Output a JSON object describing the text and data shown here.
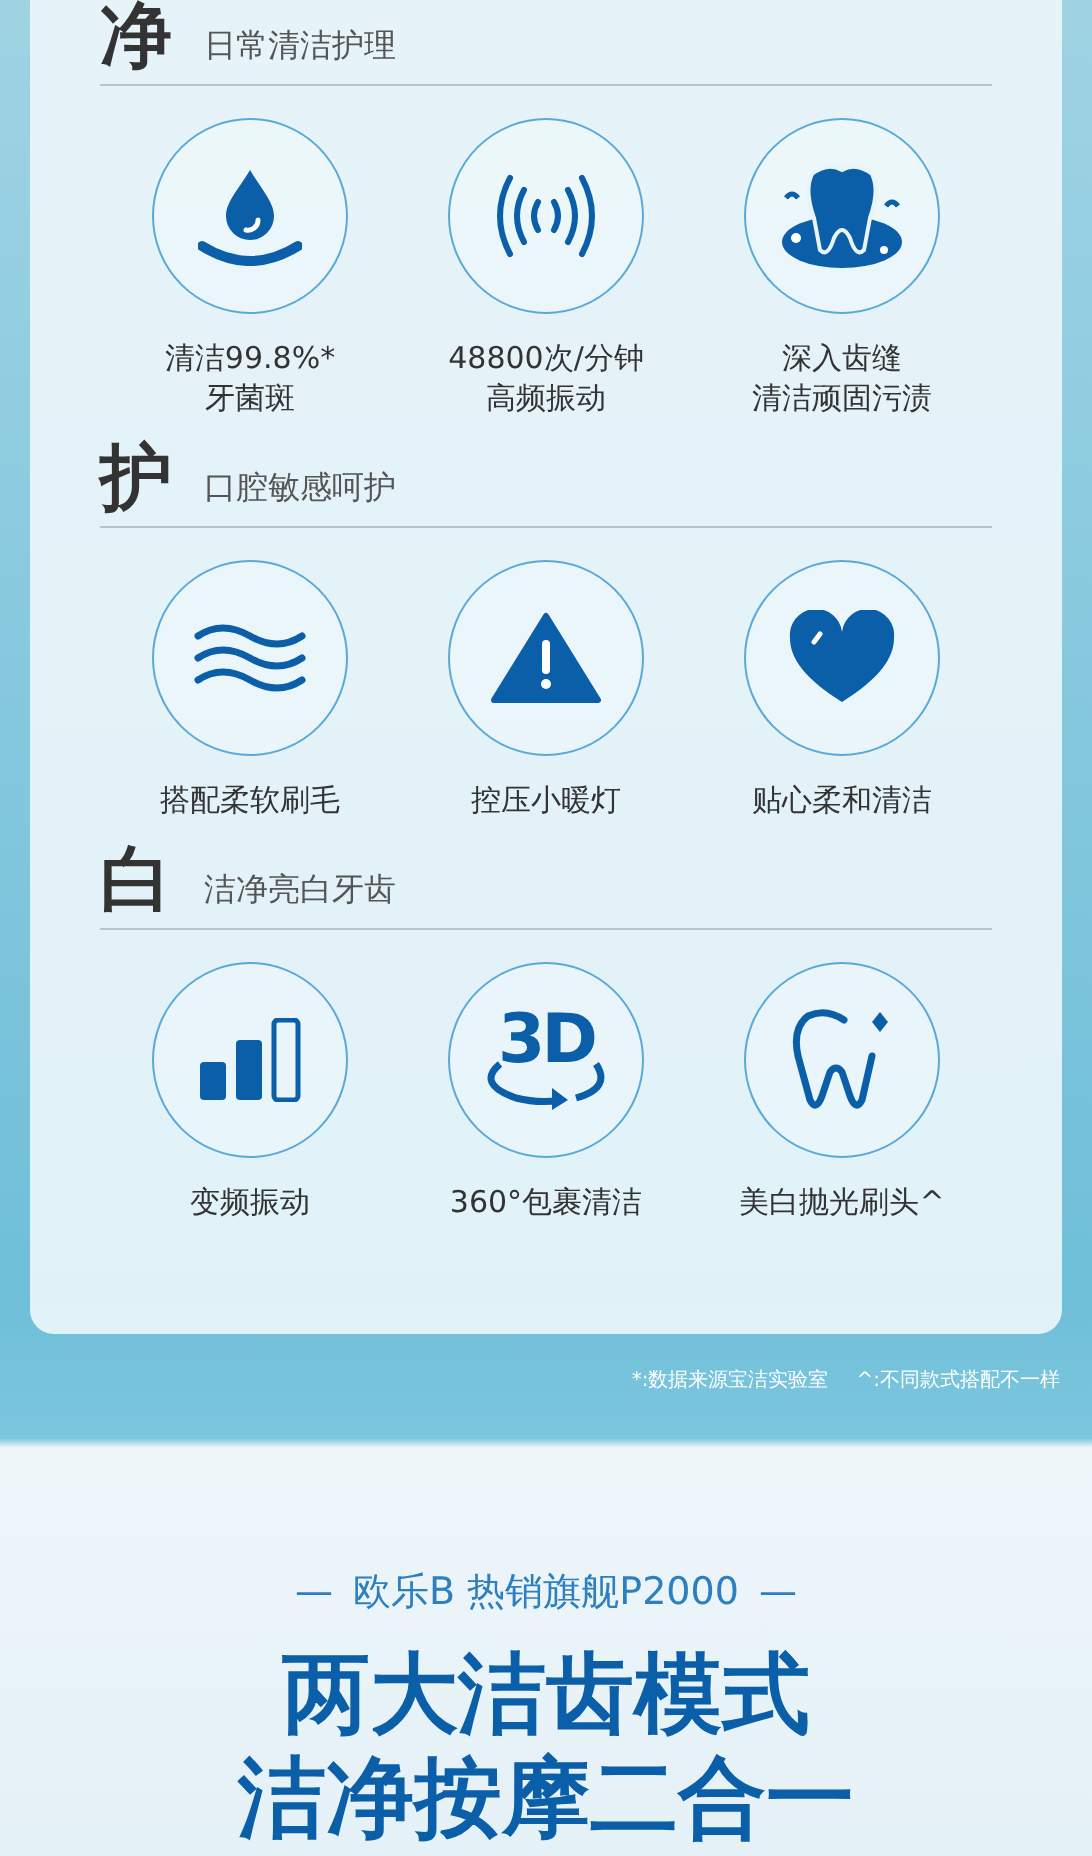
{
  "sections": [
    {
      "title": "净",
      "subtitle": "日常清洁护理",
      "features": [
        {
          "lines": [
            "清洁99.8%*",
            "牙菌斑"
          ]
        },
        {
          "lines": [
            "48800次/分钟",
            "高频振动"
          ]
        },
        {
          "lines": [
            "深入齿缝",
            "清洁顽固污渍"
          ]
        }
      ]
    },
    {
      "title": "护",
      "subtitle": "口腔敏感呵护",
      "features": [
        {
          "lines": [
            "搭配柔软刷毛"
          ]
        },
        {
          "lines": [
            "控压小暖灯"
          ]
        },
        {
          "lines": [
            "贴心柔和清洁"
          ]
        }
      ]
    },
    {
      "title": "白",
      "subtitle": "洁净亮白牙齿",
      "features": [
        {
          "lines": [
            "变频振动"
          ]
        },
        {
          "icon_text": "3D",
          "lines": [
            "360°包裹清洁"
          ]
        },
        {
          "lines": [
            "美白抛光刷头^"
          ]
        }
      ]
    }
  ],
  "footnotes": [
    "*:数据来源宝洁实验室",
    "^:不同款式搭配不一样"
  ],
  "promo": {
    "tagline": "欧乐B 热销旗舰P2000",
    "dash": "—",
    "headline": [
      "两大洁齿模式",
      "洁净按摩二合一"
    ]
  }
}
